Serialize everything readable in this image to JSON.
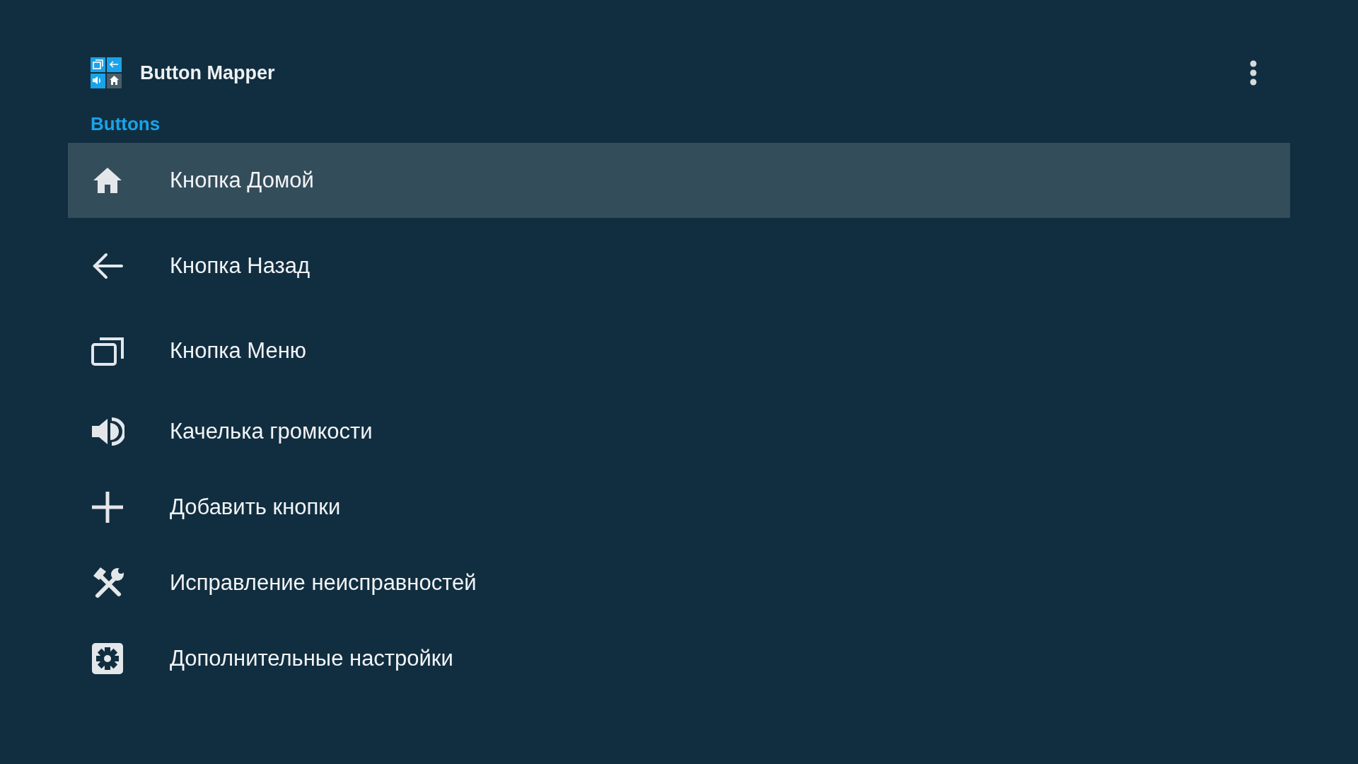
{
  "app_bar": {
    "title": "Button Mapper"
  },
  "section": {
    "title": "Buttons"
  },
  "items": [
    {
      "label": "Кнопка Домой",
      "selected": true
    },
    {
      "label": "Кнопка Назад",
      "selected": false
    },
    {
      "label": "Кнопка Меню",
      "selected": false
    },
    {
      "label": "Качелька громкости",
      "selected": false
    },
    {
      "label": "Добавить кнопки",
      "selected": false
    },
    {
      "label": "Исправление неисправностей",
      "selected": false
    },
    {
      "label": "Дополнительные настройки",
      "selected": false
    }
  ]
}
